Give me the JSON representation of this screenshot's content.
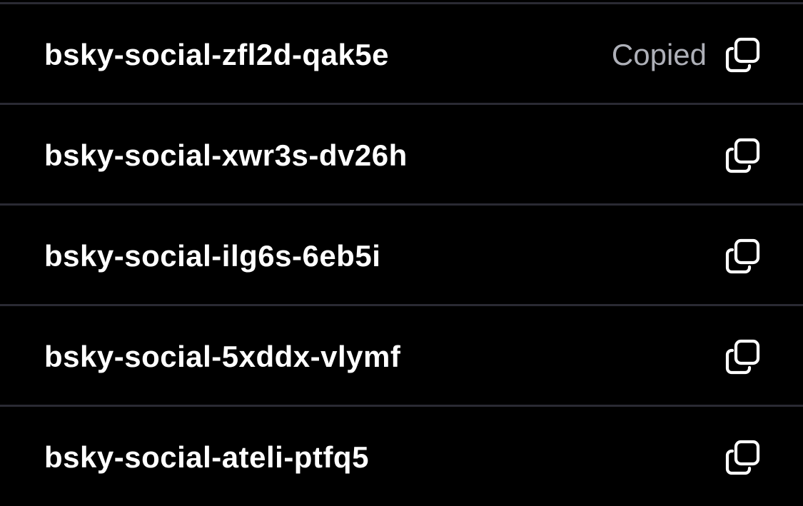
{
  "codes": [
    {
      "code": "bsky-social-zfl2d-qak5e",
      "status": "Copied",
      "icon": "copy-icon"
    },
    {
      "code": "bsky-social-xwr3s-dv26h",
      "status": "",
      "icon": "copy-icon"
    },
    {
      "code": "bsky-social-ilg6s-6eb5i",
      "status": "",
      "icon": "copy-icon"
    },
    {
      "code": "bsky-social-5xddx-vlymf",
      "status": "",
      "icon": "copy-icon"
    },
    {
      "code": "bsky-social-ateli-ptfq5",
      "status": "",
      "icon": "copy-icon"
    }
  ],
  "colors": {
    "background": "#000000",
    "divider": "#2a2a33",
    "code_text": "#ffffff",
    "status_text": "#aeb0b8"
  }
}
